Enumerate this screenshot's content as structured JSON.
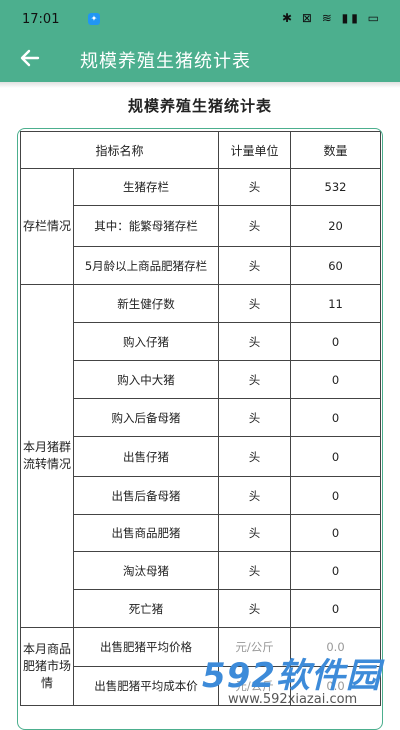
{
  "status_bar": {
    "time": "17:01",
    "app_icon": "app-notify-icon",
    "icons": "✱ ⊠ ≋ ▮▮ ▭"
  },
  "app_bar": {
    "back_icon": "arrow-left-icon",
    "title": "规模养殖生猪统计表"
  },
  "page_title": "规模养殖生猪统计表",
  "table": {
    "headers": [
      "指标名称",
      "计量单位",
      "数量"
    ],
    "groups": [
      {
        "category": "存栏情况",
        "rows": [
          {
            "name": "生猪存栏",
            "unit": "头",
            "qty": "532"
          },
          {
            "name": "其中：能繁母猪存栏",
            "unit": "头",
            "qty": "20"
          },
          {
            "name": "5月龄以上商品肥猪存栏",
            "unit": "头",
            "qty": "60"
          }
        ]
      },
      {
        "category": "本月猪群流转情况",
        "rows": [
          {
            "name": "新生健仔数",
            "unit": "头",
            "qty": "11"
          },
          {
            "name": "购入仔猪",
            "unit": "头",
            "qty": "0"
          },
          {
            "name": "购入中大猪",
            "unit": "头",
            "qty": "0"
          },
          {
            "name": "购入后备母猪",
            "unit": "头",
            "qty": "0"
          },
          {
            "name": "出售仔猪",
            "unit": "头",
            "qty": "0"
          },
          {
            "name": "出售后备母猪",
            "unit": "头",
            "qty": "0"
          },
          {
            "name": "出售商品肥猪",
            "unit": "头",
            "qty": "0"
          },
          {
            "name": "淘汰母猪",
            "unit": "头",
            "qty": "0"
          },
          {
            "name": "死亡猪",
            "unit": "头",
            "qty": "0"
          }
        ]
      },
      {
        "category": "本月商品肥猪市场情",
        "rows": [
          {
            "name": "出售肥猪平均价格",
            "unit": "元/公斤",
            "qty": "0.0"
          },
          {
            "name": "出售肥猪平均成本价",
            "unit": "元/公斤",
            "qty": "0.0"
          }
        ]
      }
    ]
  },
  "watermark": {
    "logo": "592软件园",
    "url": "www.592xiazai.com"
  },
  "colors": {
    "primary": "#4caf8e",
    "watermark": "#3d8bd9"
  }
}
